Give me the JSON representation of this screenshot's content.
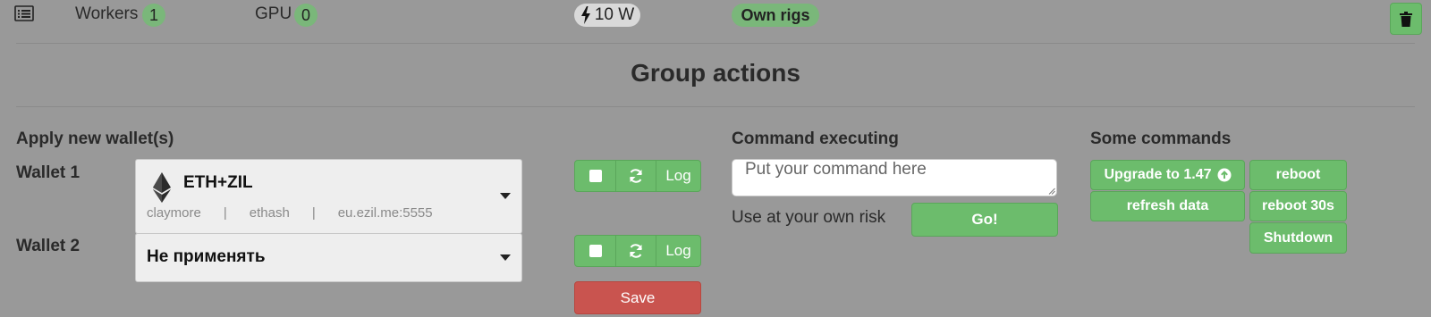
{
  "header": {
    "workers_label": "Workers",
    "workers_count": "1",
    "gpu_label": "GPU",
    "gpu_count": "0",
    "power": "10 W",
    "own_rigs": "Own rigs"
  },
  "title": "Group actions",
  "wallets": {
    "section_title": "Apply new wallet(s)",
    "items": [
      {
        "label": "Wallet 1",
        "coin": "ETH+ZIL",
        "icon": "ethereum-icon",
        "miner": "claymore",
        "algo": "ethash",
        "pool": "eu.ezil.me:5555",
        "sep": "|",
        "log_label": "Log"
      },
      {
        "label": "Wallet 2",
        "value": "Не применять",
        "log_label": "Log"
      }
    ],
    "save_label": "Save"
  },
  "command": {
    "title": "Command executing",
    "placeholder": "Put your command here",
    "warning": "Use at your own risk",
    "go_label": "Go!"
  },
  "some_commands": {
    "title": "Some commands",
    "upgrade": "Upgrade to 1.47",
    "reboot": "reboot",
    "refresh": "refresh data",
    "reboot30": "reboot 30s",
    "shutdown": "Shutdown"
  },
  "colors": {
    "background": "#999999",
    "accent_green": "#6cbc6c",
    "danger_red": "#c9544f",
    "badge_green": "#7ab77a"
  }
}
